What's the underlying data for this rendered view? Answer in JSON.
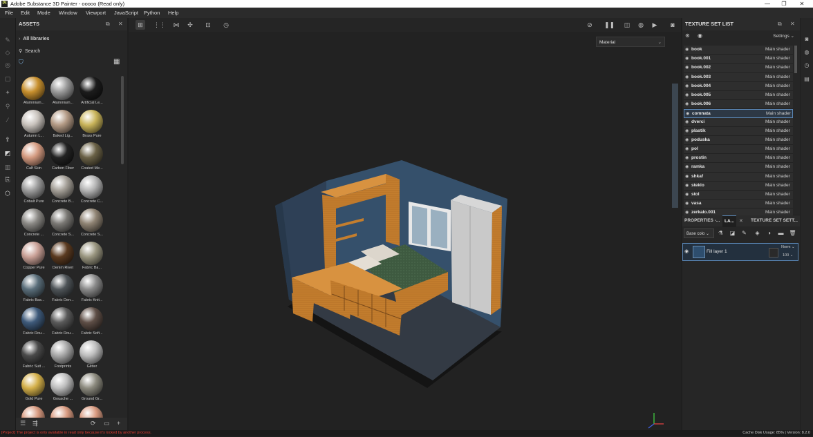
{
  "window": {
    "title": "Adobe Substance 3D Painter - ooooo (Read only)",
    "logo": "Pt",
    "controls": [
      "—",
      "❐",
      "✕"
    ]
  },
  "menu": [
    "File",
    "Edit",
    "Mode",
    "Window",
    "Viewport",
    "JavaScript",
    "Python",
    "Help"
  ],
  "assets": {
    "title": "ASSETS",
    "breadcrumb": "All libraries",
    "search_placeholder": "Search",
    "items": [
      {
        "label": "Aluminium...",
        "color": "#c8902e"
      },
      {
        "label": "Aluminium...",
        "color": "#9a9a9a"
      },
      {
        "label": "Artificial Le...",
        "color": "#1c1c1c"
      },
      {
        "label": "Autumn L...",
        "color": "#c8c2bc"
      },
      {
        "label": "Baked Lig...",
        "color": "#b39a85"
      },
      {
        "label": "Brass Pure",
        "color": "#c9b45a"
      },
      {
        "label": "Calf Skin",
        "color": "#d49a80"
      },
      {
        "label": "Carbon Fiber",
        "color": "#222222"
      },
      {
        "label": "Coated Me...",
        "color": "#6a6146"
      },
      {
        "label": "Cobalt Pure",
        "color": "#9c9c9c"
      },
      {
        "label": "Concrete B...",
        "color": "#a39e96"
      },
      {
        "label": "Concrete C...",
        "color": "#b4b4b4"
      },
      {
        "label": "Concrete ...",
        "color": "#8a8884"
      },
      {
        "label": "Concrete S...",
        "color": "#7a7874"
      },
      {
        "label": "Concrete S...",
        "color": "#8f8373"
      },
      {
        "label": "Copper Pure",
        "color": "#c9a096"
      },
      {
        "label": "Denim Rivet",
        "color": "#5a3a20"
      },
      {
        "label": "Fabric Ba...",
        "color": "#9a9680"
      },
      {
        "label": "Fabric Bas...",
        "color": "#5a6e7a"
      },
      {
        "label": "Fabric Den...",
        "color": "#4e5458"
      },
      {
        "label": "Fabric Knit...",
        "color": "#8a8a8a"
      },
      {
        "label": "Fabric Rou...",
        "color": "#3e5a7a"
      },
      {
        "label": "Fabric Rou...",
        "color": "#5a5a5a"
      },
      {
        "label": "Fabric Soft...",
        "color": "#5e4e46"
      },
      {
        "label": "Fabric Suit ...",
        "color": "#4a4a4a"
      },
      {
        "label": "Footprints",
        "color": "#a8a8a8"
      },
      {
        "label": "Glitter",
        "color": "#bdbdbd"
      },
      {
        "label": "Gold Pure",
        "color": "#d4b04a"
      },
      {
        "label": "Gouache ...",
        "color": "#bdbdbd"
      },
      {
        "label": "Ground Gr...",
        "color": "#8c8a7e"
      },
      {
        "label": "",
        "color": "#d89a80"
      },
      {
        "label": "",
        "color": "#d89a80"
      },
      {
        "label": "",
        "color": "#d89a80"
      }
    ]
  },
  "viewport": {
    "material_label": "Material"
  },
  "texture_sets": {
    "title": "TEXTURE SET LIST",
    "settings_label": "Settings",
    "rows": [
      {
        "name": "book",
        "shader": "Main shader"
      },
      {
        "name": "book.001",
        "shader": "Main shader"
      },
      {
        "name": "book.002",
        "shader": "Main shader"
      },
      {
        "name": "book.003",
        "shader": "Main shader"
      },
      {
        "name": "book.004",
        "shader": "Main shader"
      },
      {
        "name": "book.005",
        "shader": "Main shader"
      },
      {
        "name": "book.006",
        "shader": "Main shader"
      },
      {
        "name": "comnata",
        "shader": "Main shader"
      },
      {
        "name": "dverci",
        "shader": "Main shader"
      },
      {
        "name": "plastik",
        "shader": "Main shader"
      },
      {
        "name": "poduska",
        "shader": "Main shader"
      },
      {
        "name": "pol",
        "shader": "Main shader"
      },
      {
        "name": "prostin",
        "shader": "Main shader"
      },
      {
        "name": "ramka",
        "shader": "Main shader"
      },
      {
        "name": "shkaf",
        "shader": "Main shader"
      },
      {
        "name": "steklo",
        "shader": "Main shader"
      },
      {
        "name": "stol",
        "shader": "Main shader"
      },
      {
        "name": "vasa",
        "shader": "Main shader"
      },
      {
        "name": "zerkalo.001",
        "shader": "Main shader"
      }
    ],
    "selected_index": 7
  },
  "layers": {
    "tabs": [
      "PROPERTIES -...",
      "LA...",
      "TEXTURE SET SETT..."
    ],
    "channel": "Base colo",
    "layer_name": "Fill layer 1",
    "blend_mode": "Norm",
    "opacity": "100"
  },
  "status": {
    "error": "[Project] The project is only available in read only because it's locked by another process.",
    "cache": "Cache Disk Usage:   85% | Version: 8.2.0"
  }
}
